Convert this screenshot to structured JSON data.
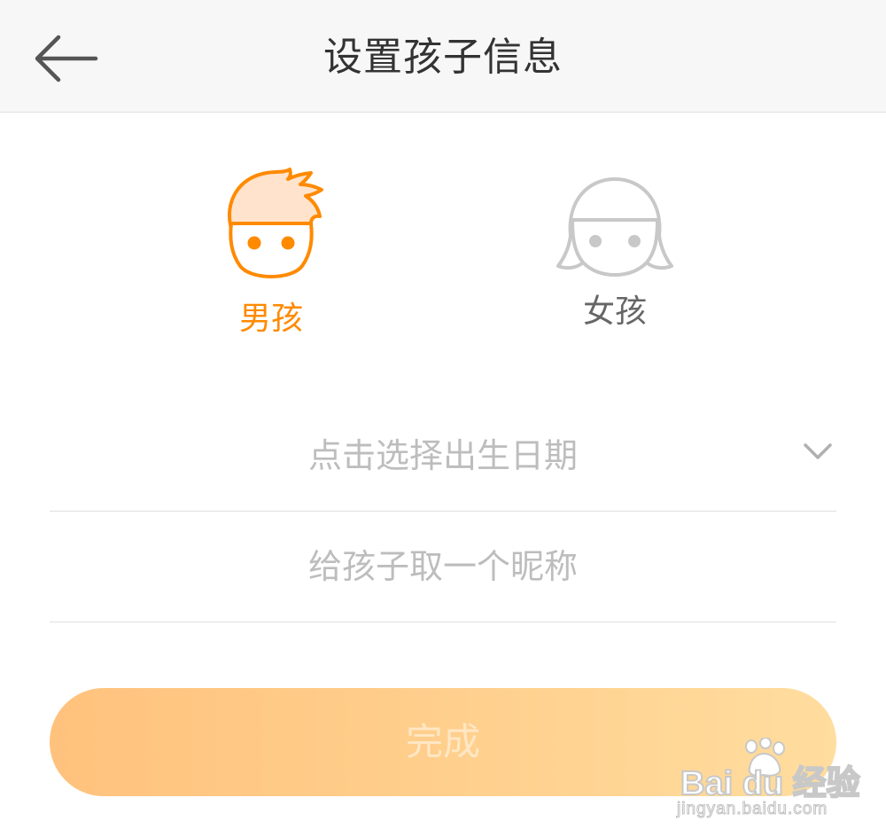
{
  "header": {
    "title": "设置孩子信息",
    "back_icon": "arrow-left-icon"
  },
  "gender": {
    "boy_label": "男孩",
    "girl_label": "女孩",
    "selected": "boy",
    "boy_icon": "boy-face-icon",
    "girl_icon": "girl-face-icon"
  },
  "form": {
    "birthdate_placeholder": "点击选择出生日期",
    "birthdate_icon": "chevron-down-icon",
    "nickname_placeholder": "给孩子取一个昵称",
    "nickname_value": ""
  },
  "actions": {
    "done_label": "完成"
  },
  "watermark": {
    "logo_text": "Bai du 经验",
    "url": "jingyan.baidu.com"
  },
  "colors": {
    "accent": "#ff8a00",
    "inactive": "#bdbdbd",
    "button_gradient_start": "#ffc27d",
    "button_gradient_end": "#ffdd9f",
    "header_bg": "#f7f7f7"
  }
}
